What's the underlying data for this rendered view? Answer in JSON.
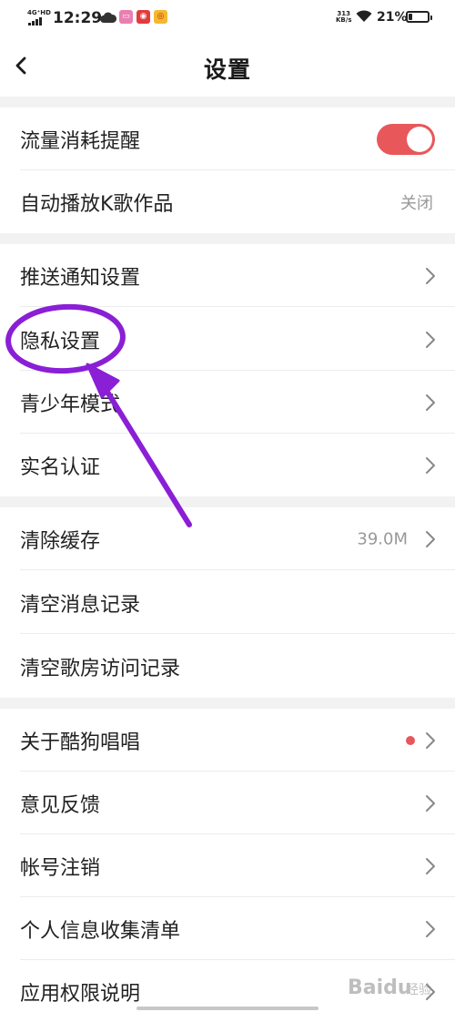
{
  "status_bar": {
    "network": "4G⁺HD",
    "time": "12:29",
    "speed_value": "313",
    "speed_unit": "KB/s",
    "battery": "21%",
    "battery_level": 0.21
  },
  "header": {
    "title": "设置",
    "back_icon": "chevron-left-icon"
  },
  "sections": [
    {
      "rows": [
        {
          "label": "流量消耗提醒",
          "control": "toggle",
          "toggle_on": true
        },
        {
          "label": "自动播放K歌作品",
          "value": "关闭",
          "chevron": false
        }
      ]
    },
    {
      "rows": [
        {
          "label": "推送通知设置",
          "chevron": true
        },
        {
          "label": "隐私设置",
          "chevron": true
        },
        {
          "label": "青少年模式",
          "chevron": true
        },
        {
          "label": "实名认证",
          "chevron": true
        }
      ]
    },
    {
      "rows": [
        {
          "label": "清除缓存",
          "value": "39.0M",
          "chevron": true
        },
        {
          "label": "清空消息记录",
          "chevron": false
        },
        {
          "label": "清空歌房访问记录",
          "chevron": false
        }
      ]
    },
    {
      "rows": [
        {
          "label": "关于酷狗唱唱",
          "chevron": true,
          "badge_dot": true
        },
        {
          "label": "意见反馈",
          "chevron": true
        },
        {
          "label": "帐号注销",
          "chevron": true
        },
        {
          "label": "个人信息收集清单",
          "chevron": true
        },
        {
          "label": "应用权限说明",
          "chevron": true
        }
      ]
    }
  ],
  "watermark": {
    "brand": "Baidu",
    "sub": "经验"
  },
  "colors": {
    "accent": "#e8575a",
    "annotation": "#8a1fd6",
    "section_gap": "#f2f2f2",
    "secondary_text": "#999999"
  }
}
